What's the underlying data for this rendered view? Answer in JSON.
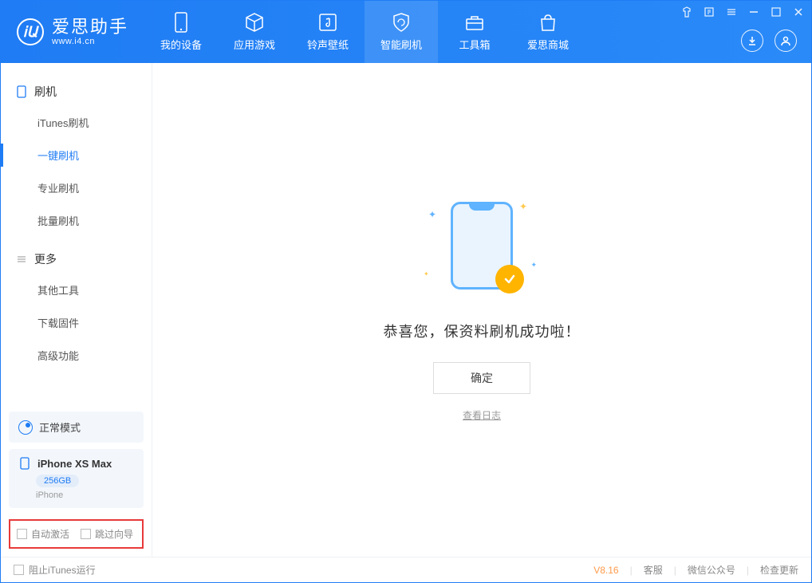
{
  "app": {
    "title": "爱思助手",
    "url": "www.i4.cn"
  },
  "tabs": [
    {
      "label": "我的设备"
    },
    {
      "label": "应用游戏"
    },
    {
      "label": "铃声壁纸"
    },
    {
      "label": "智能刷机"
    },
    {
      "label": "工具箱"
    },
    {
      "label": "爱思商城"
    }
  ],
  "sidebar": {
    "section1": {
      "title": "刷机",
      "items": [
        {
          "label": "iTunes刷机"
        },
        {
          "label": "一键刷机"
        },
        {
          "label": "专业刷机"
        },
        {
          "label": "批量刷机"
        }
      ]
    },
    "section2": {
      "title": "更多",
      "items": [
        {
          "label": "其他工具"
        },
        {
          "label": "下载固件"
        },
        {
          "label": "高级功能"
        }
      ]
    }
  },
  "device": {
    "mode": "正常模式",
    "name": "iPhone XS Max",
    "storage": "256GB",
    "type": "iPhone"
  },
  "options": {
    "auto_activate": "自动激活",
    "skip_guide": "跳过向导"
  },
  "main": {
    "success_text": "恭喜您，保资料刷机成功啦！",
    "confirm": "确定",
    "view_log": "查看日志"
  },
  "statusbar": {
    "stop_itunes": "阻止iTunes运行",
    "version": "V8.16",
    "support": "客服",
    "wechat": "微信公众号",
    "update": "检查更新"
  }
}
